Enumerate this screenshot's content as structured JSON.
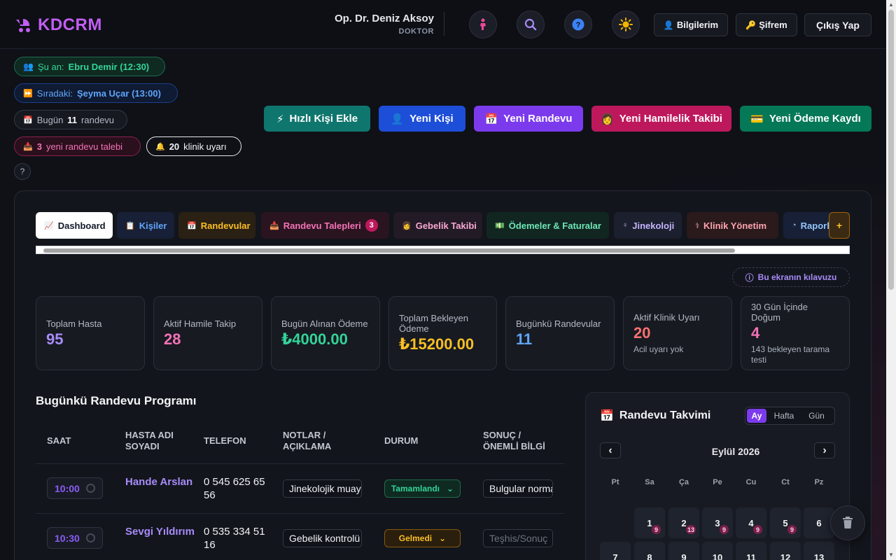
{
  "brand": {
    "name": "KDCRM"
  },
  "user": {
    "name": "Op. Dr. Deniz Aksoy",
    "role": "DOKTOR"
  },
  "topbar": {
    "profile_label": "Bilgilerim",
    "password_label": "Şifrem",
    "logout_label": "Çıkış Yap"
  },
  "status": {
    "now_label": "Şu an:",
    "now_value": "Ebru Demir (12:30)",
    "next_label": "Sıradaki:",
    "next_value": "Şeyma Uçar (13:00)",
    "today_prefix": "Bugün",
    "today_count": "11",
    "today_suffix": "randevu",
    "requests_count": "3",
    "requests_suffix": "yeni randevu talebi",
    "alerts_count": "20",
    "alerts_suffix": "klinik uyarı",
    "help": "?"
  },
  "quick_actions": [
    "Hızlı Kişi Ekle",
    "Yeni Kişi",
    "Yeni Randevu",
    "Yeni Hamilelik Takibi",
    "Yeni Ödeme Kaydı"
  ],
  "tabs": [
    {
      "label": "Dashboard"
    },
    {
      "label": "Kişiler"
    },
    {
      "label": "Randevular"
    },
    {
      "label": "Randevu Talepleri",
      "badge": "3"
    },
    {
      "label": "Gebelik Takibi"
    },
    {
      "label": "Ödemeler & Faturalar"
    },
    {
      "label": "Jinekoloji"
    },
    {
      "label": "Klinik Yönetim"
    },
    {
      "label": "Raporlar"
    }
  ],
  "guide_label": "Bu ekranın kılavuzu",
  "stats": [
    {
      "label": "Toplam Hasta",
      "value": "95",
      "color": "#a78bfa"
    },
    {
      "label": "Aktif Hamile Takip",
      "value": "28",
      "color": "#f472b6"
    },
    {
      "label": "Bugün Alınan Ödeme",
      "value": "₺4000.00",
      "color": "#34d399"
    },
    {
      "label": "Toplam Bekleyen Ödeme",
      "value": "₺15200.00",
      "color": "#fbbf24"
    },
    {
      "label": "Bugünkü Randevular",
      "value": "11",
      "color": "#60a5fa"
    },
    {
      "label": "Aktif Klinik Uyarı",
      "value": "20",
      "sub": "Acil uyarı yok",
      "color": "#f87171"
    },
    {
      "label": "30 Gün İçinde Doğum",
      "value": "4",
      "sub": "143 bekleyen tarama testi",
      "color": "#f472b6"
    }
  ],
  "schedule": {
    "title": "Bugünkü Randevu Programı",
    "columns": [
      "SAAT",
      "HASTA ADI SOYADI",
      "TELEFON",
      "NOTLAR / AÇIKLAMA",
      "DURUM",
      "SONUÇ / ÖNEMLİ BİLGİ"
    ],
    "rows": [
      {
        "time": "10:00",
        "name": "Hande Arslan",
        "phone": "0 545 625 65 56",
        "note": "Jinekolojik muayene",
        "status": "Tamamlandı",
        "result": "Bulgular normal",
        "result_placeholder": ""
      },
      {
        "time": "10:30",
        "name": "Sevgi Yıldırım",
        "phone": "0 535 334 51 16",
        "note": "Gebelik kontrolü",
        "status": "Gelmedi",
        "result": "",
        "result_placeholder": "Teşhis/Sonuç"
      }
    ]
  },
  "calendar": {
    "title": "Randevu Takvimi",
    "views": [
      "Ay",
      "Hafta",
      "Gün"
    ],
    "active_view": "Ay",
    "month": "Eylül 2026",
    "weekdays": [
      "Pt",
      "Sa",
      "Ça",
      "Pe",
      "Cu",
      "Ct",
      "Pz"
    ],
    "days_row1": [
      {
        "d": "1",
        "c": "9"
      },
      {
        "d": "2",
        "c": "13"
      },
      {
        "d": "3",
        "c": "9"
      },
      {
        "d": "4",
        "c": "9"
      },
      {
        "d": "5",
        "c": "9"
      },
      {
        "d": "6",
        "c": ""
      }
    ],
    "days_row2": [
      {
        "d": "7",
        "c": ""
      },
      {
        "d": "8",
        "c": ""
      },
      {
        "d": "9",
        "c": ""
      },
      {
        "d": "10",
        "c": ""
      },
      {
        "d": "11",
        "c": ""
      },
      {
        "d": "12",
        "c": ""
      },
      {
        "d": "13",
        "c": ""
      }
    ]
  }
}
